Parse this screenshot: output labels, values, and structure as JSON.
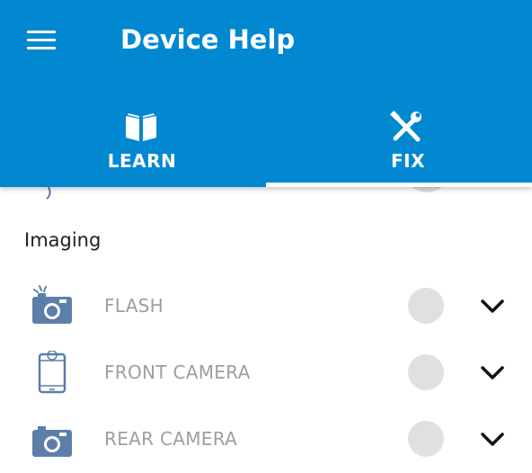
{
  "app": {
    "title": "Device Help"
  },
  "tabs": [
    {
      "label": "LEARN",
      "icon": "book-icon",
      "selected": false
    },
    {
      "label": "FIX",
      "icon": "tools-icon",
      "selected": true
    }
  ],
  "section": {
    "title": "Imaging",
    "items": [
      {
        "label": "FLASH",
        "icon": "camera-flash-icon",
        "status": "unknown"
      },
      {
        "label": "FRONT CAMERA",
        "icon": "phone-front-camera-icon",
        "status": "unknown"
      },
      {
        "label": "REAR CAMERA",
        "icon": "camera-icon",
        "status": "unknown"
      }
    ]
  },
  "colors": {
    "primary": "#0288d1",
    "icon_blue": "#5b7fa9",
    "status_idle": "#e0e0e0",
    "label_gray": "#9e9e9e"
  }
}
